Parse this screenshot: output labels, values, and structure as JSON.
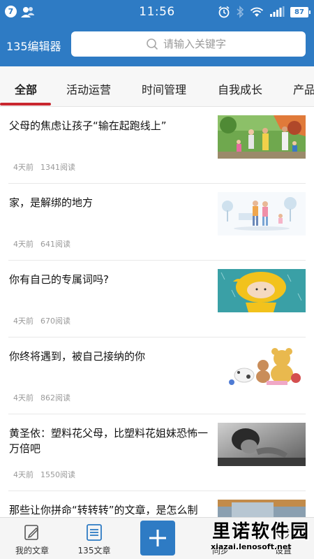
{
  "status_bar": {
    "notification_count": "7",
    "time": "11:56",
    "battery": "87"
  },
  "header": {
    "app_title": "135编辑器",
    "search_placeholder": "请输入关键字"
  },
  "tabs": [
    {
      "label": "全部",
      "active": true
    },
    {
      "label": "活动运营",
      "active": false
    },
    {
      "label": "时间管理",
      "active": false
    },
    {
      "label": "自我成长",
      "active": false
    },
    {
      "label": "产品",
      "active": false
    }
  ],
  "articles": [
    {
      "title": "父母的焦虑让孩子“输在起跑线上”",
      "age": "4天前",
      "reads": "1341阅读",
      "thumb": "family-park-photo"
    },
    {
      "title": "家，是解绑的地方",
      "age": "4天前",
      "reads": "641阅读",
      "thumb": "family-illustration"
    },
    {
      "title": "你有自己的专属词吗?",
      "age": "4天前",
      "reads": "670阅读",
      "thumb": "child-raincoat-illustration"
    },
    {
      "title": "你终将遇到，被自己接纳的你",
      "age": "4天前",
      "reads": "862阅读",
      "thumb": "teddy-bears-photo"
    },
    {
      "title": "黄圣依：塑料花父母，比塑料花姐妹恐怖一万倍吧",
      "age": "4天前",
      "reads": "1550阅读",
      "thumb": "child-bw-photo"
    },
    {
      "title": "那些让你拼命“转转转”的文章，是怎么制",
      "age": "",
      "reads": "",
      "thumb": "desk-photo"
    }
  ],
  "bottom_nav": {
    "my_articles": "我的文章",
    "articles_135": "135文章",
    "sync": "同步",
    "settings": "设置"
  },
  "watermark": {
    "brand": "里诺软件园",
    "url": "xiazai.lenosoft.net"
  },
  "colors": {
    "primary": "#2e7bc4",
    "tab_indicator": "#c9272f"
  }
}
